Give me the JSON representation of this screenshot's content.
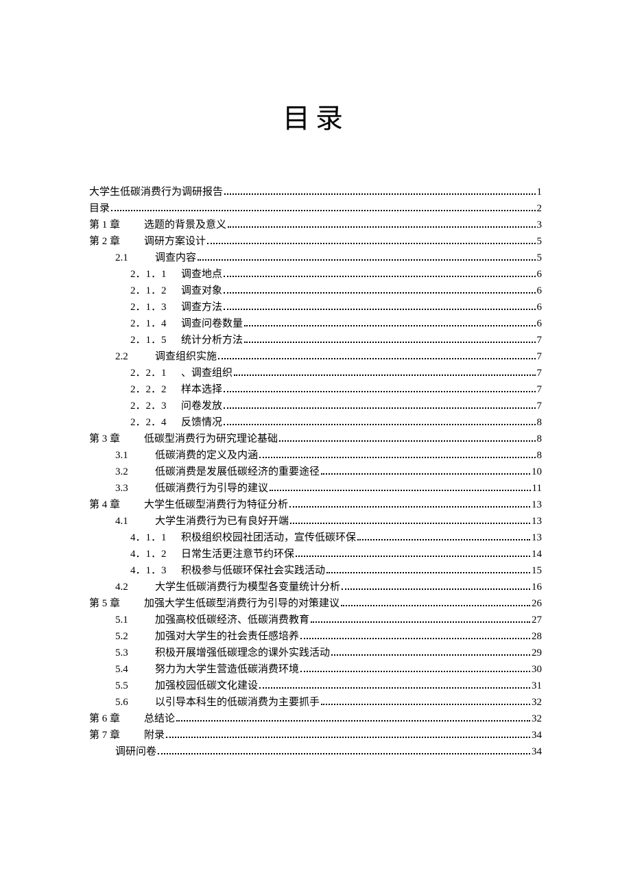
{
  "title": "目录",
  "entries": [
    {
      "level": "preline",
      "num": "",
      "text": "大学生低碳消费行为调研报告",
      "page": "1"
    },
    {
      "level": "preline",
      "num": "",
      "text": "目录",
      "page": "2"
    },
    {
      "level": "level1",
      "num": "第 1 章",
      "text": "选题的背景及意义",
      "page": "3"
    },
    {
      "level": "level1",
      "num": "第 2 章",
      "text": "调研方案设计",
      "page": "5"
    },
    {
      "level": "level2",
      "num": "2.1",
      "text": "调查内容",
      "page": "5"
    },
    {
      "level": "level3",
      "num": "2．1．1",
      "text": "调查地点",
      "page": "6"
    },
    {
      "level": "level3",
      "num": "2．1．2",
      "text": "调查对象",
      "page": "6"
    },
    {
      "level": "level3",
      "num": "2．1．3",
      "text": "调查方法",
      "page": "6"
    },
    {
      "level": "level3",
      "num": "2．1．4",
      "text": "调查问卷数量",
      "page": "6"
    },
    {
      "level": "level3",
      "num": "2．1．5",
      "text": "统计分析方法",
      "page": "7"
    },
    {
      "level": "level2",
      "num": "2.2",
      "text": "调查组织实施",
      "page": "7"
    },
    {
      "level": "level3",
      "num": "2．2．1",
      "text": "、调查组织",
      "page": "7"
    },
    {
      "level": "level3",
      "num": "2．2．2",
      "text": "样本选择",
      "page": "7"
    },
    {
      "level": "level3",
      "num": "2．2．3",
      "text": "问卷发放",
      "page": "7"
    },
    {
      "level": "level3",
      "num": "2．2．4",
      "text": "反馈情况",
      "page": "8"
    },
    {
      "level": "level1",
      "num": "第 3 章",
      "text": "低碳型消费行为研究理论基础",
      "page": "8"
    },
    {
      "level": "level2",
      "num": "3.1",
      "text": "低碳消费的定义及内涵",
      "page": "8"
    },
    {
      "level": "level2",
      "num": "3.2",
      "text": "低碳消费是发展低碳经济的重要途径",
      "page": "10"
    },
    {
      "level": "level2",
      "num": "3.3",
      "text": "低碳消费行为引导的建议",
      "page": "11"
    },
    {
      "level": "level1",
      "num": "第 4 章",
      "text": "大学生低碳型消费行为特征分析",
      "page": "13"
    },
    {
      "level": "level2",
      "num": "4.1",
      "text": "大学生消费行为已有良好开端",
      "page": "13"
    },
    {
      "level": "level3",
      "num": "4．1．1",
      "text": "积极组织校园社团活动，宣传低碳环保",
      "page": "13"
    },
    {
      "level": "level3",
      "num": "4．1．2",
      "text": "日常生活更注意节约环保",
      "page": "14"
    },
    {
      "level": "level3",
      "num": "4．1．3",
      "text": "积极参与低碳环保社会实践活动",
      "page": "15"
    },
    {
      "level": "level2",
      "num": "4.2",
      "text": "大学生低碳消费行为模型各变量统计分析",
      "page": "16"
    },
    {
      "level": "level1",
      "num": "第 5 章",
      "text": "加强大学生低碳型消费行为引导的对策建议",
      "page": "26"
    },
    {
      "level": "level2",
      "num": "5.1",
      "text": "加强高校低碳经济、低碳消费教育",
      "page": "27"
    },
    {
      "level": "level2",
      "num": "5.2",
      "text": "加强对大学生的社会责任感培养",
      "page": "28"
    },
    {
      "level": "level2",
      "num": "5.3",
      "text": "积极开展增强低碳理念的课外实践活动",
      "page": "29"
    },
    {
      "level": "level2",
      "num": "5.4",
      "text": "努力为大学生营造低碳消费环境",
      "page": "30"
    },
    {
      "level": "level2",
      "num": "5.5",
      "text": "加强校园低碳文化建设",
      "page": "31"
    },
    {
      "level": "level2",
      "num": "5.6",
      "text": "以引导本科生的低碳消费为主要抓手",
      "page": "32"
    },
    {
      "level": "level1",
      "num": "第 6 章",
      "text": "总结论",
      "page": "32"
    },
    {
      "level": "level1",
      "num": "第 7 章",
      "text": "附录",
      "page": "34"
    },
    {
      "level": "subline",
      "num": "",
      "text": "调研问卷",
      "page": "34"
    }
  ]
}
